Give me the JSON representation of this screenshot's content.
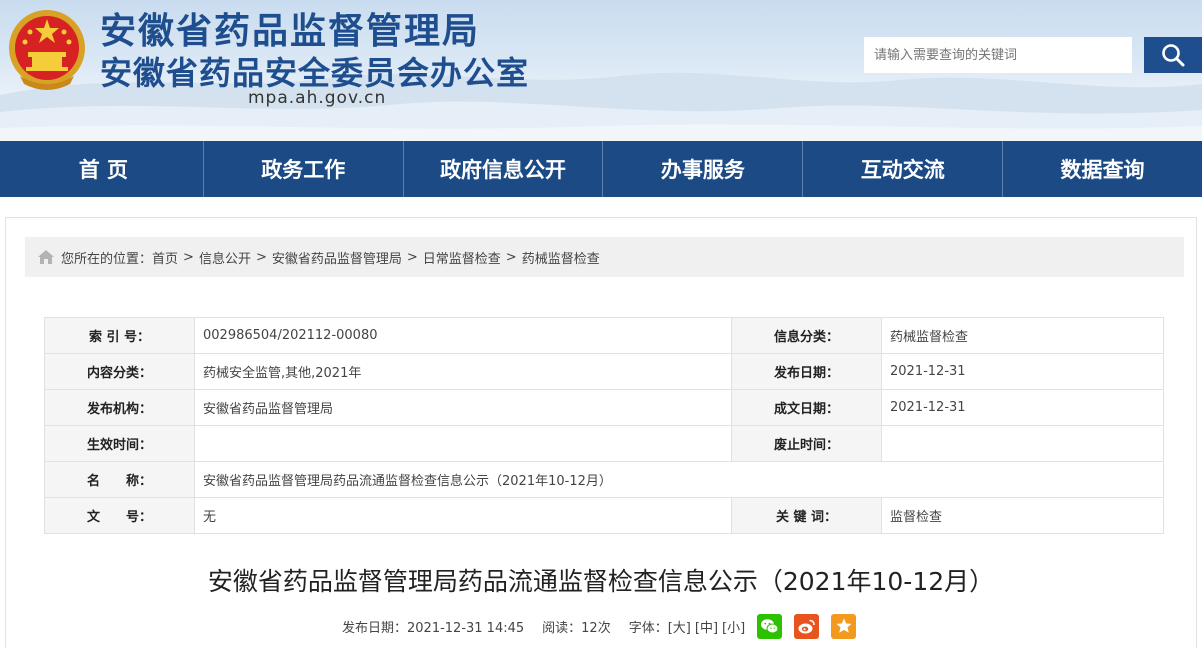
{
  "header": {
    "title_line1": "安徽省药品监督管理局",
    "title_line2": "安徽省药品安全委员会办公室",
    "domain": "mpa.ah.gov.cn",
    "search_placeholder": "请输入需要查询的关键词"
  },
  "nav": [
    "首 页",
    "政务工作",
    "政府信息公开",
    "办事服务",
    "互动交流",
    "数据查询"
  ],
  "breadcrumb": {
    "prefix": "您所在的位置：",
    "items": [
      "首页",
      "信息公开",
      "安徽省药品监督管理局",
      "日常监督检查",
      "药械监督检查"
    ],
    "separator": ">"
  },
  "meta": {
    "index_label": "索 引 号：",
    "index_value": "002986504/202112-00080",
    "category_label": "信息分类：",
    "category_value": "药械监督检查",
    "content_label": "内容分类：",
    "content_value": "药械安全监管,其他,2021年",
    "pubdate_label": "发布日期：",
    "pubdate_value": "2021-12-31",
    "org_label": "发布机构：",
    "org_value": "安徽省药品监督管理局",
    "docdate_label": "成文日期：",
    "docdate_value": "2021-12-31",
    "effective_label": "生效时间：",
    "effective_value": "",
    "expire_label": "废止时间：",
    "expire_value": "",
    "name_label": "名　　称：",
    "name_value": "安徽省药品监督管理局药品流通监督检查信息公示（2021年10-12月）",
    "docno_label": "文　　号：",
    "docno_value": "无",
    "keywords_label": "关 键 词：",
    "keywords_value": "监督检查"
  },
  "article": {
    "title": "安徽省药品监督管理局药品流通监督检查信息公示（2021年10-12月）",
    "pubdate": "发布日期：2021-12-31 14:45",
    "reads": "阅读：12次",
    "font_label": "字体：",
    "font_large": "[大]",
    "font_medium": "[中]",
    "font_small": "[小]"
  },
  "colors": {
    "brand_blue": "#1f4e8f",
    "nav_bg": "#1c4a85",
    "wechat": "#2dc100",
    "weibo": "#e8541e",
    "favorite": "#f39a1e"
  },
  "icons": [
    "national-emblem-icon",
    "search-icon",
    "home-icon",
    "wechat-icon",
    "weibo-icon",
    "star-icon"
  ]
}
